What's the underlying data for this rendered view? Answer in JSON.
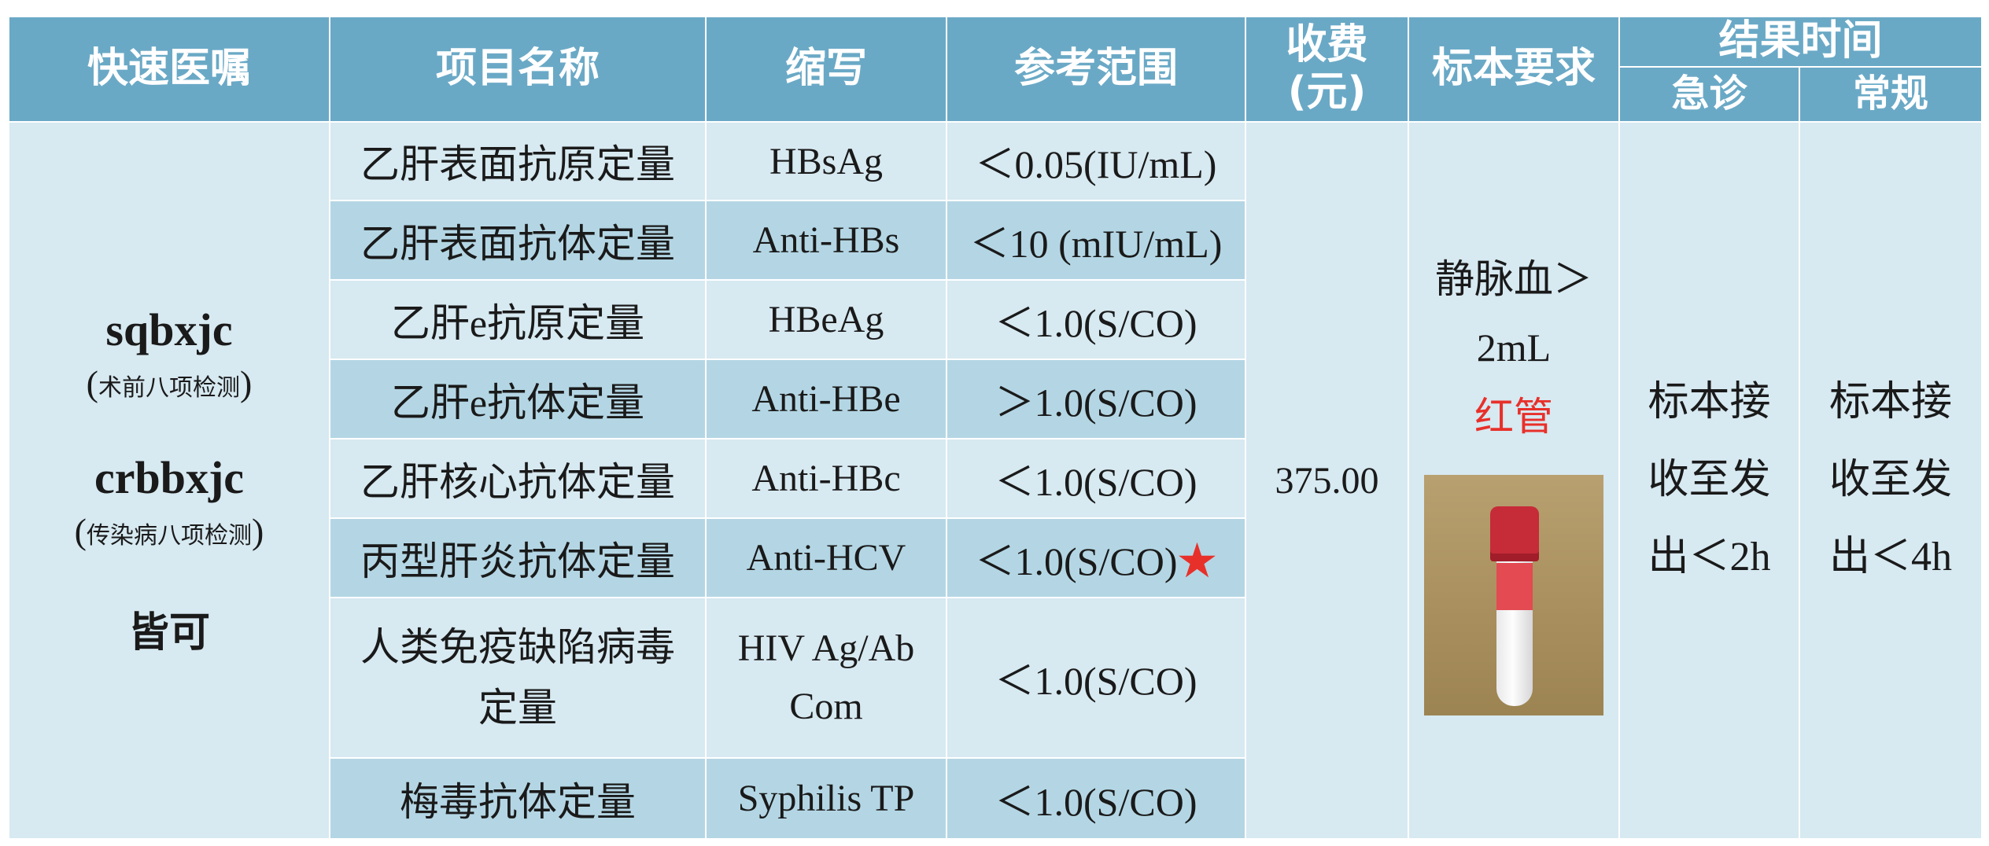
{
  "headers": {
    "advice": "快速医嘱",
    "item_name": "项目名称",
    "abbr": "缩写",
    "range": "参考范围",
    "fee": "收费",
    "fee_unit": "(元)",
    "specimen": "标本要求",
    "result_time": "结果时间",
    "urgent": "急诊",
    "routine": "常规"
  },
  "advice": {
    "code1": "sqbxjc",
    "note1": "术前八项检测",
    "code2": "crbbxjc",
    "note2": "传染病八项检测",
    "either": "皆可",
    "paren_open": "(",
    "paren_close": ")"
  },
  "rows": [
    {
      "name": "乙肝表面抗原定量",
      "abbr": "HBsAg",
      "range": "＜0.05(IU/mL)"
    },
    {
      "name": "乙肝表面抗体定量",
      "abbr": "Anti-HBs",
      "range": "＜10 (mIU/mL)"
    },
    {
      "name": "乙肝e抗原定量",
      "abbr": "HBeAg",
      "range": "＜1.0(S/CO)"
    },
    {
      "name": "乙肝e抗体定量",
      "abbr": "Anti-HBe",
      "range": "＞1.0(S/CO)"
    },
    {
      "name": "乙肝核心抗体定量",
      "abbr": "Anti-HBc",
      "range": "＜1.0(S/CO)"
    },
    {
      "name": "丙型肝炎抗体定量",
      "abbr": "Anti-HCV",
      "range": "＜1.0(S/CO)",
      "mark": "★"
    },
    {
      "name_line1": "人类免疫缺陷病毒",
      "name_line2": "定量",
      "abbr_line1": "HIV Ag/Ab",
      "abbr_line2": "Com",
      "range": "＜1.0(S/CO)"
    },
    {
      "name": "梅毒抗体定量",
      "abbr": "Syphilis  TP",
      "range": "＜1.0(S/CO)"
    }
  ],
  "fee": "375.00",
  "specimen": {
    "line1": "静脉血＞",
    "line2": "2mL",
    "tube": "红管"
  },
  "time": {
    "urgent": [
      "标本接",
      "收至发",
      "出＜2h"
    ],
    "routine": [
      "标本接",
      "收至发",
      "出＜4h"
    ]
  }
}
